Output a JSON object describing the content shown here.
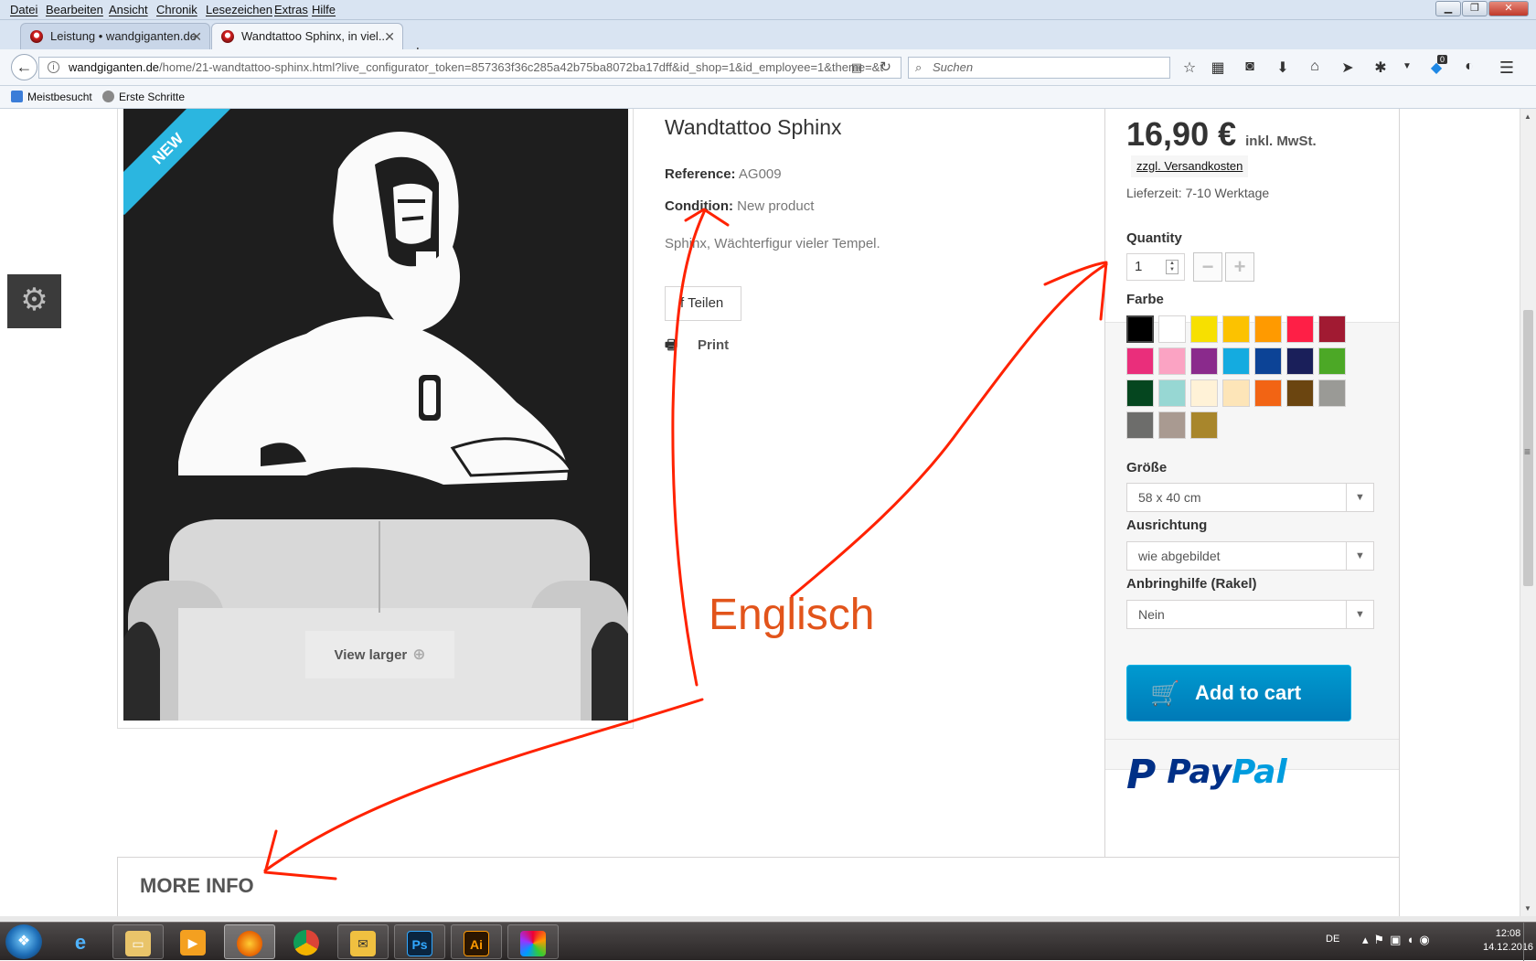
{
  "browser": {
    "menu": [
      "Datei",
      "Bearbeiten",
      "Ansicht",
      "Chronik",
      "Lesezeichen",
      "Extras",
      "Hilfe"
    ],
    "tabs": [
      {
        "title": "Leistung • wandgiganten.de"
      },
      {
        "title": "Wandtattoo Sphinx, in viel..."
      }
    ],
    "url_host": "wandgiganten.de",
    "url_path": "/home/21-wandtattoo-sphinx.html?live_configurator_token=857363f36c285a42b75ba8072ba17dff&id_shop=1&id_employee=1&theme=&t",
    "search_placeholder": "Suchen",
    "badge_count": "0",
    "bookmarks": [
      "Meistbesucht",
      "Erste Schritte"
    ]
  },
  "product": {
    "new_badge": "NEW",
    "view_larger": "View larger",
    "title": "Wandtattoo Sphinx",
    "reference_label": "Reference:",
    "reference_value": "AG009",
    "condition_label": "Condition:",
    "condition_value": "New product",
    "description": "Sphinx, Wächterfigur vieler Tempel.",
    "share_label": "f Teilen",
    "print_label": "Print"
  },
  "buybox": {
    "price": "16,90 €",
    "tax_note": "inkl. MwSt.",
    "shipping_link": "zzgl. Versandkosten",
    "delivery": "Lieferzeit: 7-10 Werktage",
    "quantity_label": "Quantity",
    "quantity_value": "1",
    "color_label": "Farbe",
    "colors": [
      "#000000",
      "#ffffff",
      "#f7e000",
      "#fcc200",
      "#ff9a00",
      "#fe1f46",
      "#a11a32",
      "#ea2e7b",
      "#fba3c3",
      "#8a2a8c",
      "#14abe0",
      "#0c4396",
      "#1a1f5a",
      "#4ca826",
      "#05461f",
      "#97d7d3",
      "#fff2d7",
      "#fde5b8",
      "#f26414",
      "#6b4510",
      "#9a9a96",
      "#6d6d6b",
      "#a99a91",
      "#a8862c"
    ],
    "size_label": "Größe",
    "size_value": "58 x 40 cm",
    "orientation_label": "Ausrichtung",
    "orientation_value": "wie abgebildet",
    "helper_label": "Anbringhilfe (Rakel)",
    "helper_value": "Nein",
    "cart_label": "Add to cart",
    "paypal_1": "Pay",
    "paypal_2": "Pal"
  },
  "more_info": "MORE INFO",
  "annotation": "Englisch",
  "annotation_color": "#e2541b",
  "taskbar": {
    "language": "DE",
    "time": "12:08",
    "date": "14.12.2016"
  }
}
